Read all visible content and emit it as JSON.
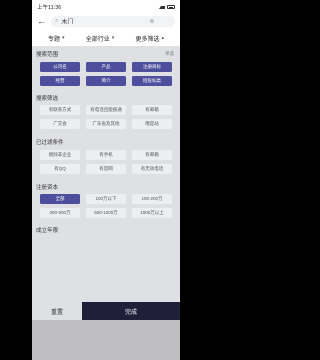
{
  "status_bar": {
    "time": "上午11:36"
  },
  "search": {
    "value": "木门"
  },
  "filter_tabs": [
    "专题",
    "全部行业",
    "更多筛选"
  ],
  "sections": [
    {
      "title": "搜索范围",
      "extra": "单选",
      "chips": [
        "公司名",
        "产品",
        "注册商标",
        "经营",
        "简介",
        "招投标类"
      ],
      "selected": [
        0,
        1,
        2,
        3,
        4,
        5
      ]
    },
    {
      "title": "搜索筛选",
      "extra": "",
      "chips": [
        "有联系方式",
        "有电话且能拨通",
        "有邮箱",
        "广交会",
        "广东省及其他",
        "哦是站"
      ],
      "selected": []
    },
    {
      "title": "已过滤条件",
      "extra": "",
      "chips": [
        "剔除非企业",
        "有手机",
        "有邮箱",
        "有QQ",
        "有官网",
        "有无效电话"
      ],
      "selected": []
    },
    {
      "title": "注册资本",
      "extra": "",
      "chips": [
        "全部",
        "100万以下",
        "100-200万",
        "300-500万",
        "500-1000万",
        "1000万以上"
      ],
      "selected": [
        0
      ]
    },
    {
      "title": "成立年限",
      "extra": "",
      "chips": [],
      "selected": []
    }
  ],
  "bottom": {
    "reset": "重置",
    "done": "完成"
  },
  "colors": {
    "accent": "#4d4f9c",
    "done_bg": "#1f1f3a",
    "panel_bg": "#dfe0e3",
    "chip_bg": "#eceef1"
  }
}
